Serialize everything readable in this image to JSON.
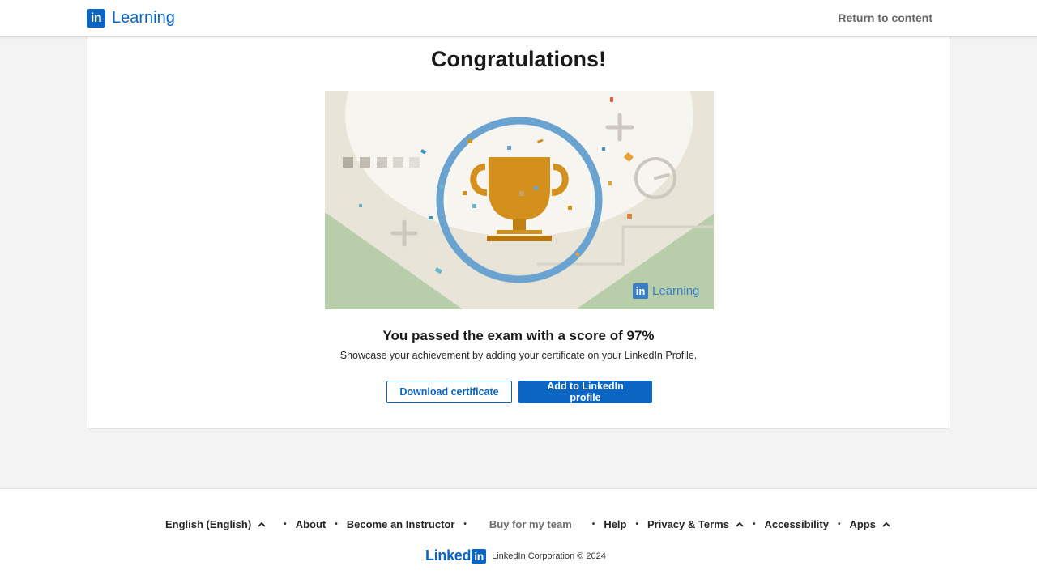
{
  "header": {
    "brand_badge": "in",
    "brand_name": "Learning",
    "return_label": "Return to content"
  },
  "card": {
    "title": "Congratulations!",
    "illustration_badge": "in",
    "illustration_brand": "Learning",
    "score_text": "You passed the exam with a score of 97%",
    "score_percent": 97,
    "subtitle": "Showcase your achievement by adding your certificate on your LinkedIn Profile.",
    "download_label": "Download certificate",
    "add_profile_label": "Add to LinkedIn profile"
  },
  "footer": {
    "links": {
      "language": "English (English)",
      "about": "About",
      "instructor": "Become an Instructor",
      "team": "Buy for my team",
      "help": "Help",
      "privacy": "Privacy & Terms",
      "accessibility": "Accessibility",
      "apps": "Apps"
    },
    "logo_text": "Linked",
    "logo_box": "in",
    "copyright": "LinkedIn Corporation © 2024"
  },
  "colors": {
    "brand_blue": "#0a66c2",
    "trophy_gold": "#d4901c",
    "ring_blue": "#6aa3d0",
    "hill_green": "#b8ceaa"
  }
}
